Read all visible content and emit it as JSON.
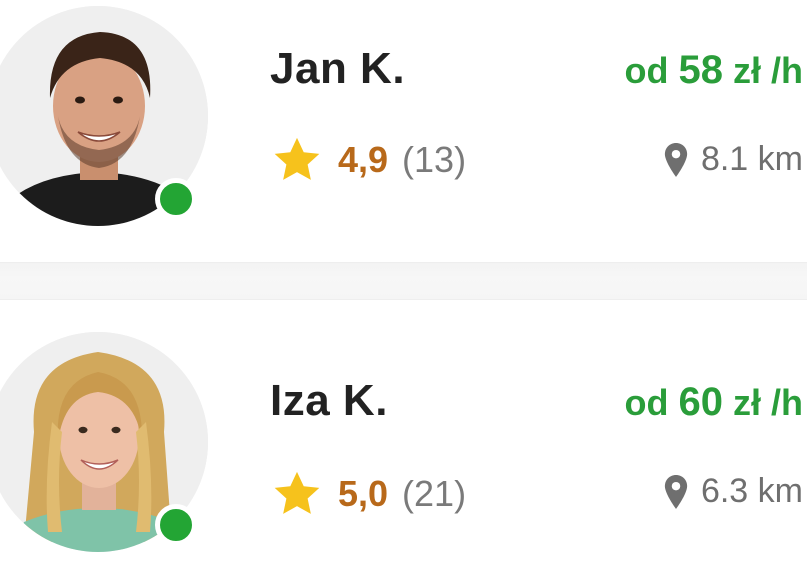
{
  "colors": {
    "price": "#2a9d3a",
    "rating": "#b8691a",
    "online": "#23a534",
    "star": "#f6c21c"
  },
  "providers": [
    {
      "name": "Jan K.",
      "price_prefix": "od",
      "price_amount": "58",
      "price_unit": "zł /h",
      "rating": "4,9",
      "reviews": "(13)",
      "distance": "8.1 km",
      "online": true,
      "icons": {
        "rating": "star-icon",
        "distance": "location-pin-icon"
      }
    },
    {
      "name": "Iza K.",
      "price_prefix": "od",
      "price_amount": "60",
      "price_unit": "zł /h",
      "rating": "5,0",
      "reviews": "(21)",
      "distance": "6.3 km",
      "online": true,
      "icons": {
        "rating": "star-icon",
        "distance": "location-pin-icon"
      }
    }
  ]
}
